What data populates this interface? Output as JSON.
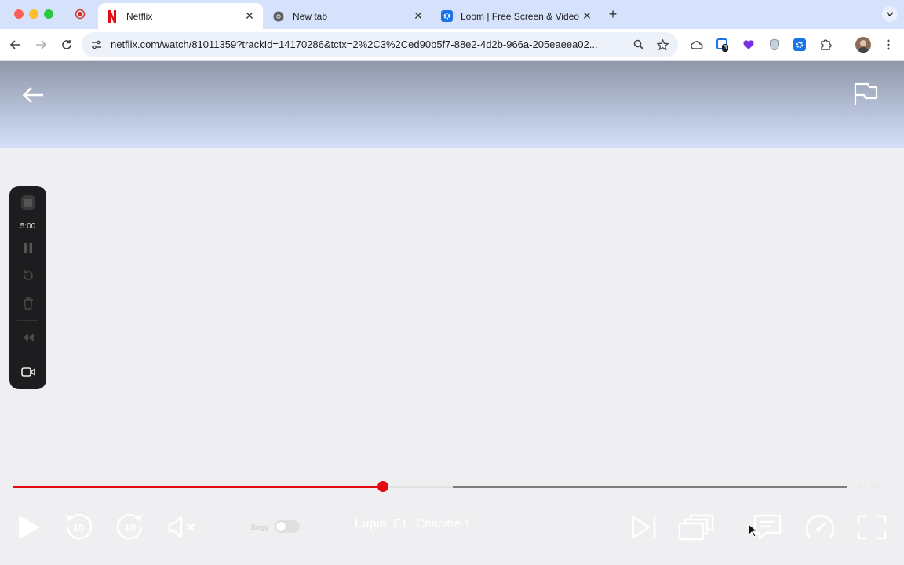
{
  "browser": {
    "tabs": [
      {
        "title": "Netflix",
        "active": true
      },
      {
        "title": "New tab",
        "active": false
      },
      {
        "title": "Loom | Free Screen & Video R",
        "active": false
      }
    ],
    "url": "netflix.com/watch/81011359?trackId=14170286&tctx=2%2C3%2Ced90b5f7-88e2-4d2b-966a-205eaeea02...",
    "extension_badge": "3"
  },
  "loom_toolbar": {
    "timer": "5:00"
  },
  "player": {
    "progress_fraction": 0.444,
    "buffered_fraction": 0.527,
    "time_remaining": "27:02",
    "skip_back_seconds": "10",
    "skip_forward_seconds": "10",
    "toggle_label": "Bingy",
    "show_title": "Lupin",
    "episode": "E1",
    "episode_title": "Chapitre 1"
  },
  "colors": {
    "netflix_red": "#e50914",
    "tab_strip": "#d6e2fb"
  }
}
